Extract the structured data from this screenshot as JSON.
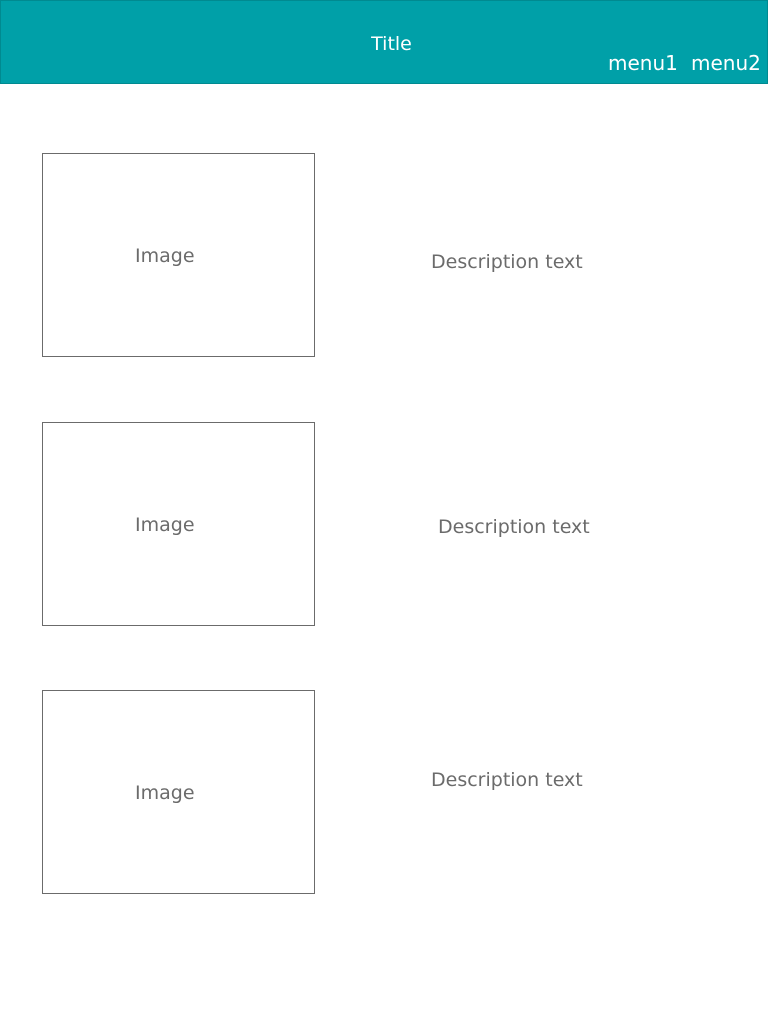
{
  "header": {
    "title": "Title",
    "menu": [
      "menu1",
      "menu2"
    ],
    "background_color": "#00a0a8"
  },
  "cards": [
    {
      "image_label": "Image",
      "description": "Description text"
    },
    {
      "image_label": "Image",
      "description": "Description text"
    },
    {
      "image_label": "Image",
      "description": "Description text"
    }
  ]
}
